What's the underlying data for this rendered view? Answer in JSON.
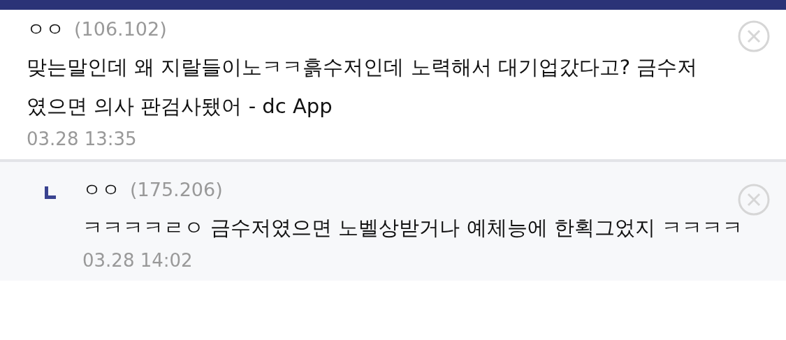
{
  "comments": [
    {
      "kind": "comment",
      "nickname": "ㅇㅇ",
      "ip": "(106.102)",
      "text": "맞는말인데 왜 지랄들이노ㅋㅋ흙수저인데 노력해서 대기업갔다고? 금수저 였으면 의사 판검사됐어 - dc App",
      "date": "03.28 13:35"
    },
    {
      "kind": "reply",
      "nickname": "ㅇㅇ",
      "ip": "(175.206)",
      "text": "ㅋㅋㅋㅋㄹㅇ 금수저였으면 노벨상받거나 예체능에 한획그었지 ㅋㅋㅋㅋ",
      "date": "03.28 14:02"
    }
  ]
}
